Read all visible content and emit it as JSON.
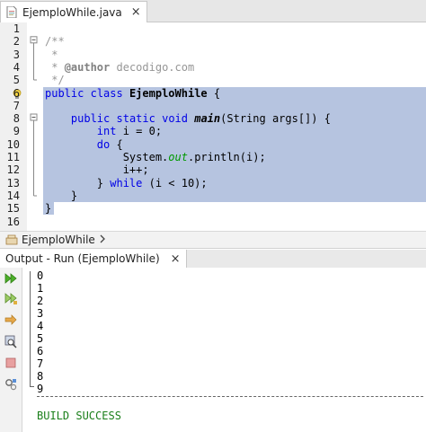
{
  "editor_tab": {
    "label": "EjemploWhile.java",
    "close": "×"
  },
  "lines": [
    {
      "n": "1",
      "text": ""
    },
    {
      "n": "2",
      "text": "/**"
    },
    {
      "n": "3",
      "text": " *"
    },
    {
      "n": "4",
      "text": " * @author decodigo.com"
    },
    {
      "n": "5",
      "text": " */"
    },
    {
      "n": "6",
      "text": "public class EjemploWhile {"
    },
    {
      "n": "7",
      "text": ""
    },
    {
      "n": "8",
      "text": "    public static void main(String args[]) {"
    },
    {
      "n": "9",
      "text": "        int i = 0;"
    },
    {
      "n": "10",
      "text": "        do {"
    },
    {
      "n": "11",
      "text": "            System.out.println(i);"
    },
    {
      "n": "12",
      "text": "            i++;"
    },
    {
      "n": "13",
      "text": "        } while (i < 10);"
    },
    {
      "n": "14",
      "text": "    }"
    },
    {
      "n": "15",
      "text": "}"
    },
    {
      "n": "16",
      "text": ""
    }
  ],
  "breadcrumb": {
    "label": "EjemploWhile"
  },
  "output_tab": {
    "label": "Output - Run (EjemploWhile)",
    "close": "×"
  },
  "output_lines": [
    "0",
    "1",
    "2",
    "3",
    "4",
    "5",
    "6",
    "7",
    "8",
    "9"
  ],
  "build_result": "BUILD SUCCESS",
  "colors": {
    "selection": "#b6c4e0",
    "keyword": "#0000e6",
    "success": "#1a7f1a"
  },
  "toolbar_icons": [
    "rerun-icon",
    "rerun-with-params-icon",
    "stop-icon",
    "settings-icon",
    "clear-icon",
    "options-icon"
  ]
}
